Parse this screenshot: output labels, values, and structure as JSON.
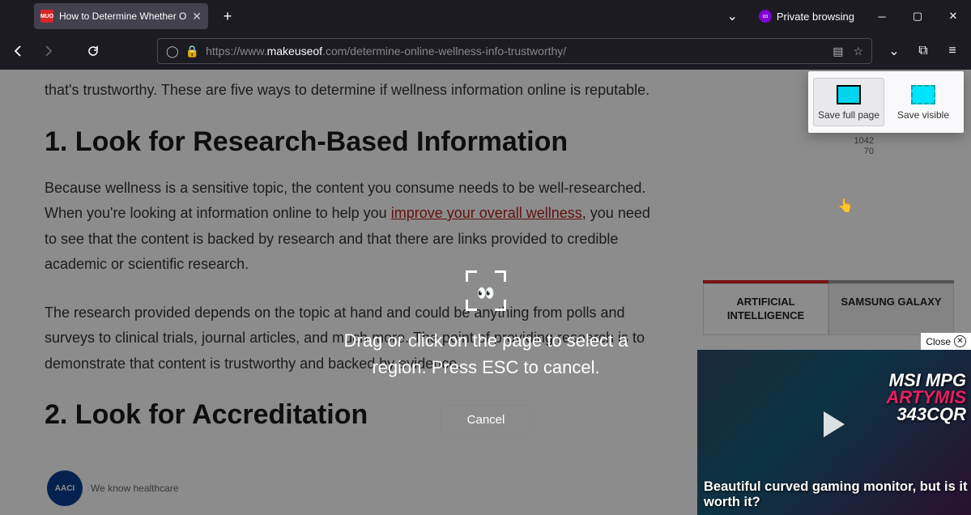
{
  "window": {
    "tab_title": "How to Determine Whether Onl",
    "private_label": "Private browsing",
    "url_prefix": "https://www.",
    "url_host": "makeuseof",
    "url_rest": ".com/determine-online-wellness-info-trustworthy/"
  },
  "article": {
    "intro": "that's trustworthy. These are five ways to determine if wellness information online is reputable.",
    "h1": "1. Look for Research-Based Information",
    "p1a": "Because wellness is a sensitive topic, the content you consume needs to be well-researched. When you're looking at information online to help you ",
    "p1_link": "improve your overall wellness",
    "p1b": ", you need to see that the content is backed by research and that there are links provided to credible academic or scientific research.",
    "p2": "The research provided depends on the topic at hand and could be anything from polls and surveys to clinical trials, journal articles, and much more. The point of providing research is to demonstrate that content is trustworthy and backed by evidence.",
    "h2": "2. Look for Accreditation",
    "aaci_badge": "AACI",
    "aaci_text": "We know healthcare"
  },
  "sidebar": {
    "tab1": "ARTIFICIAL INTELLIGENCE",
    "tab2": "SAMSUNG GALAXY"
  },
  "screenshot": {
    "save_full": "Save full page",
    "save_visible": "Save visible",
    "coords1": "1042",
    "coords2": "70",
    "instruction": "Drag or click on the page to select a region. Press ESC to cancel.",
    "cancel": "Cancel"
  },
  "video": {
    "close": "Close",
    "title1": "MSI MPG",
    "title2": "ARTYMIS",
    "title3": "343CQR",
    "caption": "Beautiful curved gaming monitor, but is it worth it?"
  }
}
